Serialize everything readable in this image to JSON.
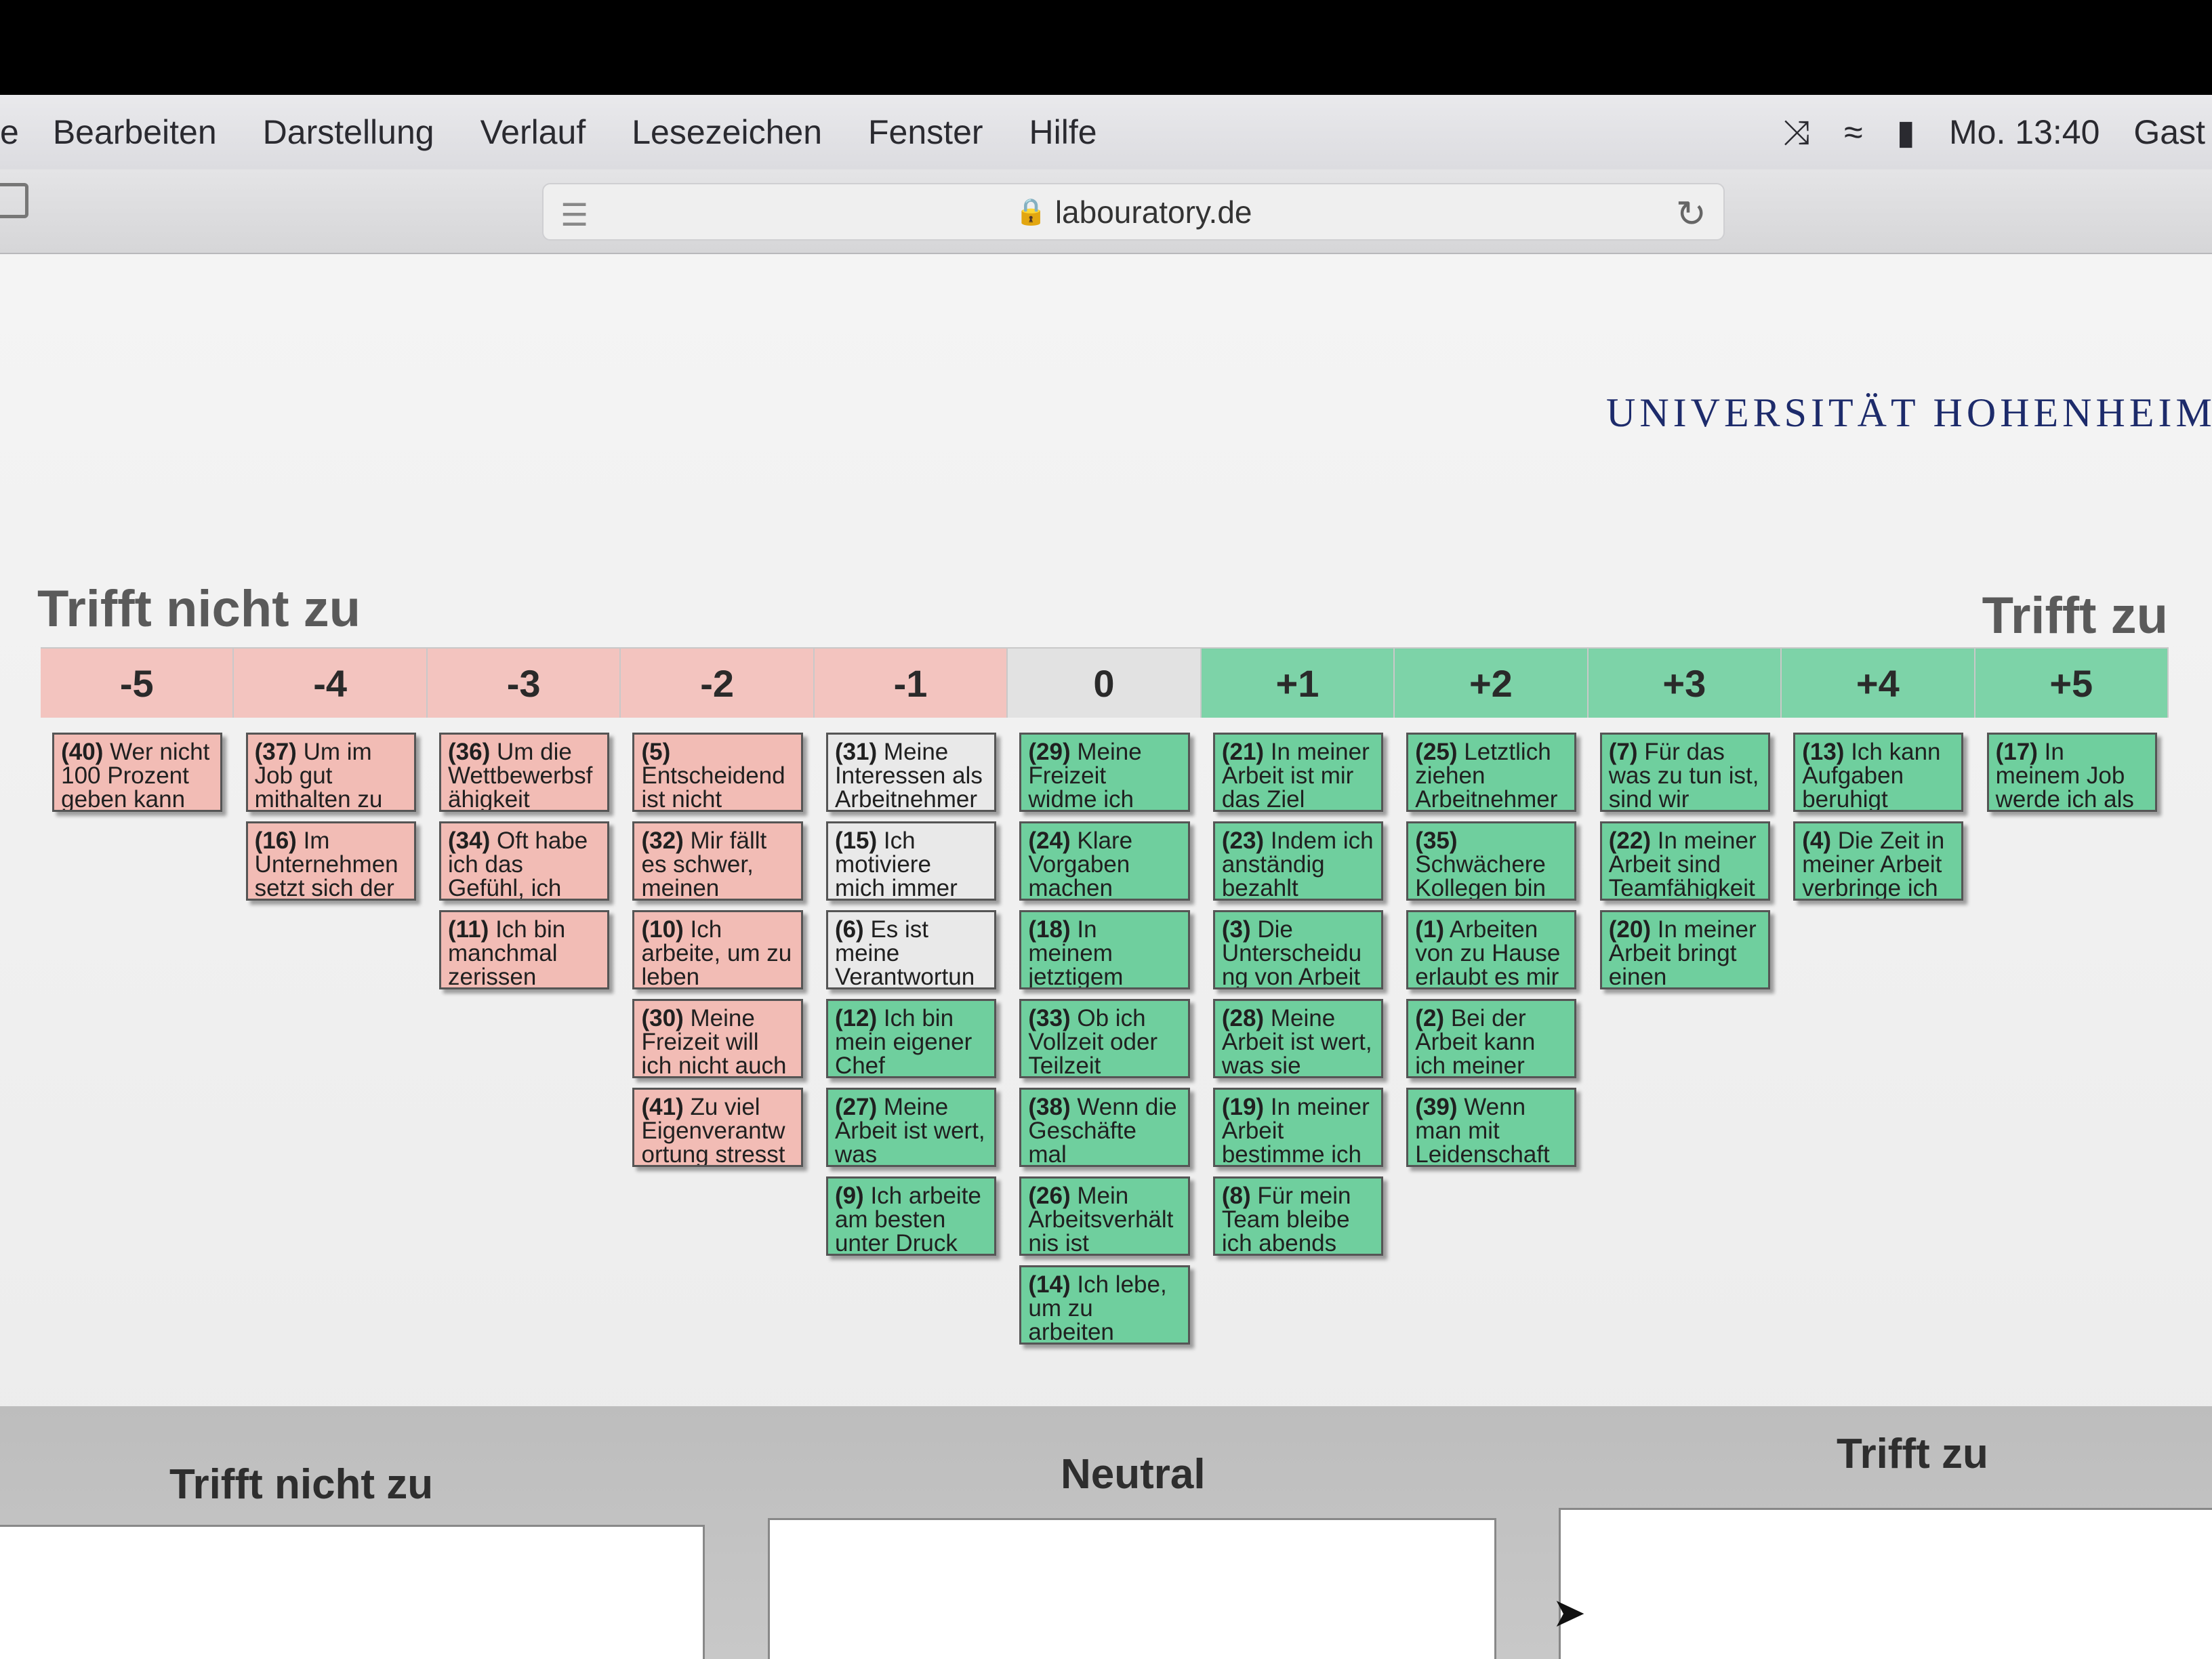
{
  "menubar": {
    "items": [
      "e",
      "Bearbeiten",
      "Darstellung",
      "Verlauf",
      "Lesezeichen",
      "Fenster",
      "Hilfe"
    ],
    "clock": "Mo. 13:40",
    "user": "Gast",
    "icons": [
      "feather-icon",
      "wifi-icon",
      "battery-icon"
    ]
  },
  "browser": {
    "url": "labouratory.de"
  },
  "page": {
    "logo": "UNIVERSITÄT HOHENHEIM",
    "left_pole": "Trifft nicht zu",
    "right_pole": "Trifft zu",
    "scale": [
      {
        "label": "-5",
        "tone": "neg"
      },
      {
        "label": "-4",
        "tone": "neg"
      },
      {
        "label": "-3",
        "tone": "neg"
      },
      {
        "label": "-2",
        "tone": "neg"
      },
      {
        "label": "-1",
        "tone": "neg"
      },
      {
        "label": "0",
        "tone": "zero"
      },
      {
        "label": "+1",
        "tone": "pos"
      },
      {
        "label": "+2",
        "tone": "pos"
      },
      {
        "label": "+3",
        "tone": "pos"
      },
      {
        "label": "+4",
        "tone": "pos"
      },
      {
        "label": "+5",
        "tone": "pos"
      }
    ],
    "columns": [
      [
        {
          "num": "(40)",
          "text": "Wer nicht 100 Prozent geben kann",
          "tone": "neg"
        }
      ],
      [
        {
          "num": "(37)",
          "text": "Um im Job gut mithalten zu",
          "tone": "neg"
        },
        {
          "num": "(16)",
          "text": "Im Unternehmen setzt sich der",
          "tone": "neg"
        }
      ],
      [
        {
          "num": "(36)",
          "text": "Um die Wettbewerbsf ähigkeit",
          "tone": "neg"
        },
        {
          "num": "(34)",
          "text": "Oft habe ich das Gefühl, ich",
          "tone": "neg"
        },
        {
          "num": "(11)",
          "text": "Ich bin manchmal zerissen",
          "tone": "neg"
        }
      ],
      [
        {
          "num": "(5)",
          "text": "Entscheidend ist nicht",
          "tone": "neg"
        },
        {
          "num": "(32)",
          "text": "Mir fällt es schwer, meinen",
          "tone": "neg"
        },
        {
          "num": "(10)",
          "text": "Ich arbeite, um zu leben",
          "tone": "neg"
        },
        {
          "num": "(30)",
          "text": "Meine Freizeit will ich nicht auch",
          "tone": "neg"
        },
        {
          "num": "(41)",
          "text": "Zu viel Eigenverantw ortung stresst",
          "tone": "neg"
        }
      ],
      [
        {
          "num": "(31)",
          "text": "Meine Interessen als Arbeitnehmer",
          "tone": "neu"
        },
        {
          "num": "(15)",
          "text": "Ich motiviere mich immer",
          "tone": "neu"
        },
        {
          "num": "(6)",
          "text": "Es ist meine Verantwortun",
          "tone": "neu"
        },
        {
          "num": "(12)",
          "text": "Ich bin mein eigener Chef",
          "tone": "pos"
        },
        {
          "num": "(27)",
          "text": "Meine Arbeit ist wert, was",
          "tone": "pos"
        },
        {
          "num": "(9)",
          "text": "Ich arbeite am besten unter Druck",
          "tone": "pos"
        }
      ],
      [
        {
          "num": "(29)",
          "text": "Meine Freizeit widme ich meinen",
          "tone": "pos"
        },
        {
          "num": "(24)",
          "text": "Klare Vorgaben machen",
          "tone": "pos"
        },
        {
          "num": "(18)",
          "text": "In meinem jetztigem Unternehmen",
          "tone": "pos"
        },
        {
          "num": "(33)",
          "text": "Ob ich Vollzeit oder Teilzeit",
          "tone": "pos"
        },
        {
          "num": "(38)",
          "text": "Wenn die Geschäfte mal",
          "tone": "pos"
        },
        {
          "num": "(26)",
          "text": "Mein Arbeitsverhält nis ist",
          "tone": "pos"
        },
        {
          "num": "(14)",
          "text": "Ich lebe, um zu arbeiten",
          "tone": "pos"
        }
      ],
      [
        {
          "num": "(21)",
          "text": "In meiner Arbeit ist mir das Ziel",
          "tone": "pos"
        },
        {
          "num": "(23)",
          "text": "Indem ich anständig bezahlt",
          "tone": "pos"
        },
        {
          "num": "(3)",
          "text": "Die Unterscheidu ng von Arbeit",
          "tone": "pos"
        },
        {
          "num": "(28)",
          "text": "Meine Arbeit ist wert, was sie",
          "tone": "pos"
        },
        {
          "num": "(19)",
          "text": "In meiner Arbeit bestimme ich",
          "tone": "pos"
        },
        {
          "num": "(8)",
          "text": "Für mein Team bleibe ich abends",
          "tone": "pos"
        }
      ],
      [
        {
          "num": "(25)",
          "text": "Letztlich ziehen Arbeitnehmer",
          "tone": "pos"
        },
        {
          "num": "(35)",
          "text": "Schwächere Kollegen bin",
          "tone": "pos"
        },
        {
          "num": "(1)",
          "text": "Arbeiten von zu Hause erlaubt es mir",
          "tone": "pos"
        },
        {
          "num": "(2)",
          "text": "Bei der Arbeit kann ich meiner",
          "tone": "pos"
        },
        {
          "num": "(39)",
          "text": "Wenn man mit Leidenschaft",
          "tone": "pos"
        }
      ],
      [
        {
          "num": "(7)",
          "text": "Für das was zu tun ist, sind wir",
          "tone": "pos"
        },
        {
          "num": "(22)",
          "text": "In meiner Arbeit sind Teamfähigkeit",
          "tone": "pos"
        },
        {
          "num": "(20)",
          "text": "In meiner Arbeit bringt einen",
          "tone": "pos"
        }
      ],
      [
        {
          "num": "(13)",
          "text": "Ich kann Aufgaben beruhigt",
          "tone": "pos"
        },
        {
          "num": "(4)",
          "text": "Die Zeit in meiner Arbeit verbringe ich",
          "tone": "pos"
        }
      ],
      [
        {
          "num": "(17)",
          "text": "In meinem Job werde ich als",
          "tone": "pos"
        }
      ]
    ],
    "bottom": {
      "left_title": "Trifft nicht zu",
      "center_title": "Neutral",
      "right_title": "Trifft zu"
    }
  }
}
